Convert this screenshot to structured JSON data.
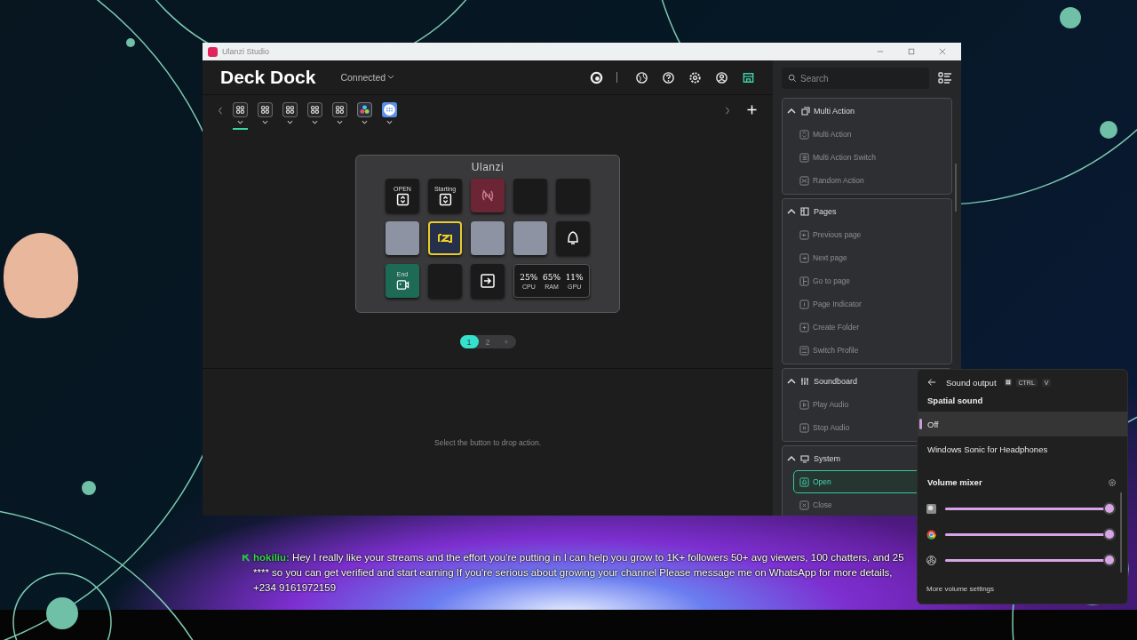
{
  "window": {
    "title": "Ulanzi Studio"
  },
  "app": {
    "title": "Deck Dock",
    "status": "Connected"
  },
  "device_tabs": [
    {
      "kind": "grid",
      "selected": true
    },
    {
      "kind": "grid",
      "selected": false
    },
    {
      "kind": "grid",
      "selected": false
    },
    {
      "kind": "grid",
      "selected": false
    },
    {
      "kind": "grid",
      "selected": false
    },
    {
      "kind": "palette",
      "selected": false
    },
    {
      "kind": "keypad",
      "selected": false
    }
  ],
  "deck": {
    "title": "Ulanzi",
    "keys": [
      {
        "kind": "action",
        "label": "OPEN"
      },
      {
        "kind": "action",
        "label": "Starting"
      },
      {
        "kind": "signal"
      },
      {
        "kind": "empty"
      },
      {
        "kind": "empty"
      },
      {
        "kind": "image"
      },
      {
        "kind": "logo"
      },
      {
        "kind": "image"
      },
      {
        "kind": "image"
      },
      {
        "kind": "bell"
      },
      {
        "kind": "record",
        "label": "End"
      },
      {
        "kind": "empty"
      },
      {
        "kind": "enter"
      },
      {
        "kind": "stats",
        "metrics": [
          {
            "value": "25%",
            "label": "CPU"
          },
          {
            "value": "65%",
            "label": "RAM"
          },
          {
            "value": "11%",
            "label": "GPU"
          }
        ]
      }
    ]
  },
  "pages": [
    {
      "label": "1",
      "selected": true
    },
    {
      "label": "2",
      "selected": false
    }
  ],
  "add_page": "+",
  "hint": "Select the button to drop action.",
  "actions": {
    "search": {
      "placeholder": "Search"
    },
    "groups": [
      {
        "title": "Multi Action",
        "kind": "multi",
        "expanded": true,
        "items": [
          {
            "label": "Multi Action",
            "kind": "updown",
            "selected": false
          },
          {
            "label": "Multi Action Switch",
            "kind": "stack",
            "selected": false
          },
          {
            "label": "Random Action",
            "kind": "shuffle",
            "selected": false
          }
        ]
      },
      {
        "title": "Pages",
        "kind": "pages",
        "expanded": true,
        "items": [
          {
            "label": "Previous page",
            "kind": "prev",
            "selected": false
          },
          {
            "label": "Next page",
            "kind": "next",
            "selected": false
          },
          {
            "label": "Go to page",
            "kind": "goto",
            "selected": false
          },
          {
            "label": "Page Indicator",
            "kind": "indicator",
            "selected": false
          },
          {
            "label": "Create Folder",
            "kind": "folder",
            "selected": false
          },
          {
            "label": "Switch Profile",
            "kind": "profile",
            "selected": false
          }
        ]
      },
      {
        "title": "Soundboard",
        "kind": "sliders",
        "expanded": true,
        "items": [
          {
            "label": "Play Audio",
            "kind": "play",
            "selected": false
          },
          {
            "label": "Stop Audio",
            "kind": "stop",
            "selected": false
          }
        ]
      },
      {
        "title": "System",
        "kind": "system",
        "expanded": true,
        "items": [
          {
            "label": "Open",
            "kind": "bell",
            "selected": true
          },
          {
            "label": "Close",
            "kind": "close",
            "selected": false
          }
        ]
      }
    ]
  },
  "sound_flyout": {
    "title": "Sound output",
    "shortcut": [
      "CTRL",
      "V"
    ],
    "spatial_title": "Spatial sound",
    "options": [
      {
        "label": "Off",
        "selected": true
      },
      {
        "label": "Windows Sonic for Headphones",
        "selected": false
      }
    ],
    "mixer_title": "Volume mixer",
    "apps": [
      {
        "kind": "game",
        "level": 0.98
      },
      {
        "kind": "browser",
        "level": 0.98
      },
      {
        "kind": "recorder",
        "level": 0.98
      }
    ],
    "more": "More volume settings"
  },
  "chat": {
    "user": "hokiliu:",
    "message": "Hey I really like your streams and the effort you're putting in I can help you grow to 1K+ followers 50+ avg viewers, 100 chatters, and 25 **** so you can get verified and start earning If you're serious about growing your channel Please message me on WhatsApp for more details, +234 9161972159"
  }
}
